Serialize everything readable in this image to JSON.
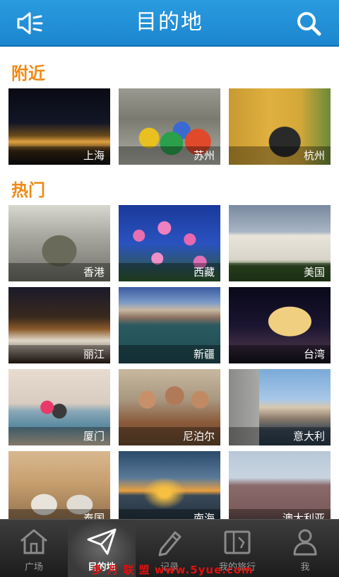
{
  "header": {
    "title": "目的地",
    "menu_icon": "speaker-menu-icon",
    "search_icon": "search-icon"
  },
  "sections": {
    "nearby": {
      "title": "附近"
    },
    "hot": {
      "title": "热门"
    }
  },
  "nearby_cities": [
    "上海",
    "苏州",
    "杭州"
  ],
  "hot_destinations": [
    "香港",
    "西藏",
    "美国",
    "丽江",
    "新疆",
    "台湾",
    "厦门",
    "尼泊尔",
    "意大利",
    "泰国",
    "南海",
    "澳大利亚"
  ],
  "tabbar": {
    "items": [
      {
        "label": "广场",
        "icon": "home-icon"
      },
      {
        "label": "目的地",
        "icon": "paper-plane-icon"
      },
      {
        "label": "记录",
        "icon": "pencil-icon"
      },
      {
        "label": "我的旅行",
        "icon": "map-book-icon"
      },
      {
        "label": "我",
        "icon": "person-icon"
      }
    ],
    "active_index": 1
  },
  "watermark": "多 月 联 盟  www.5yue.com"
}
